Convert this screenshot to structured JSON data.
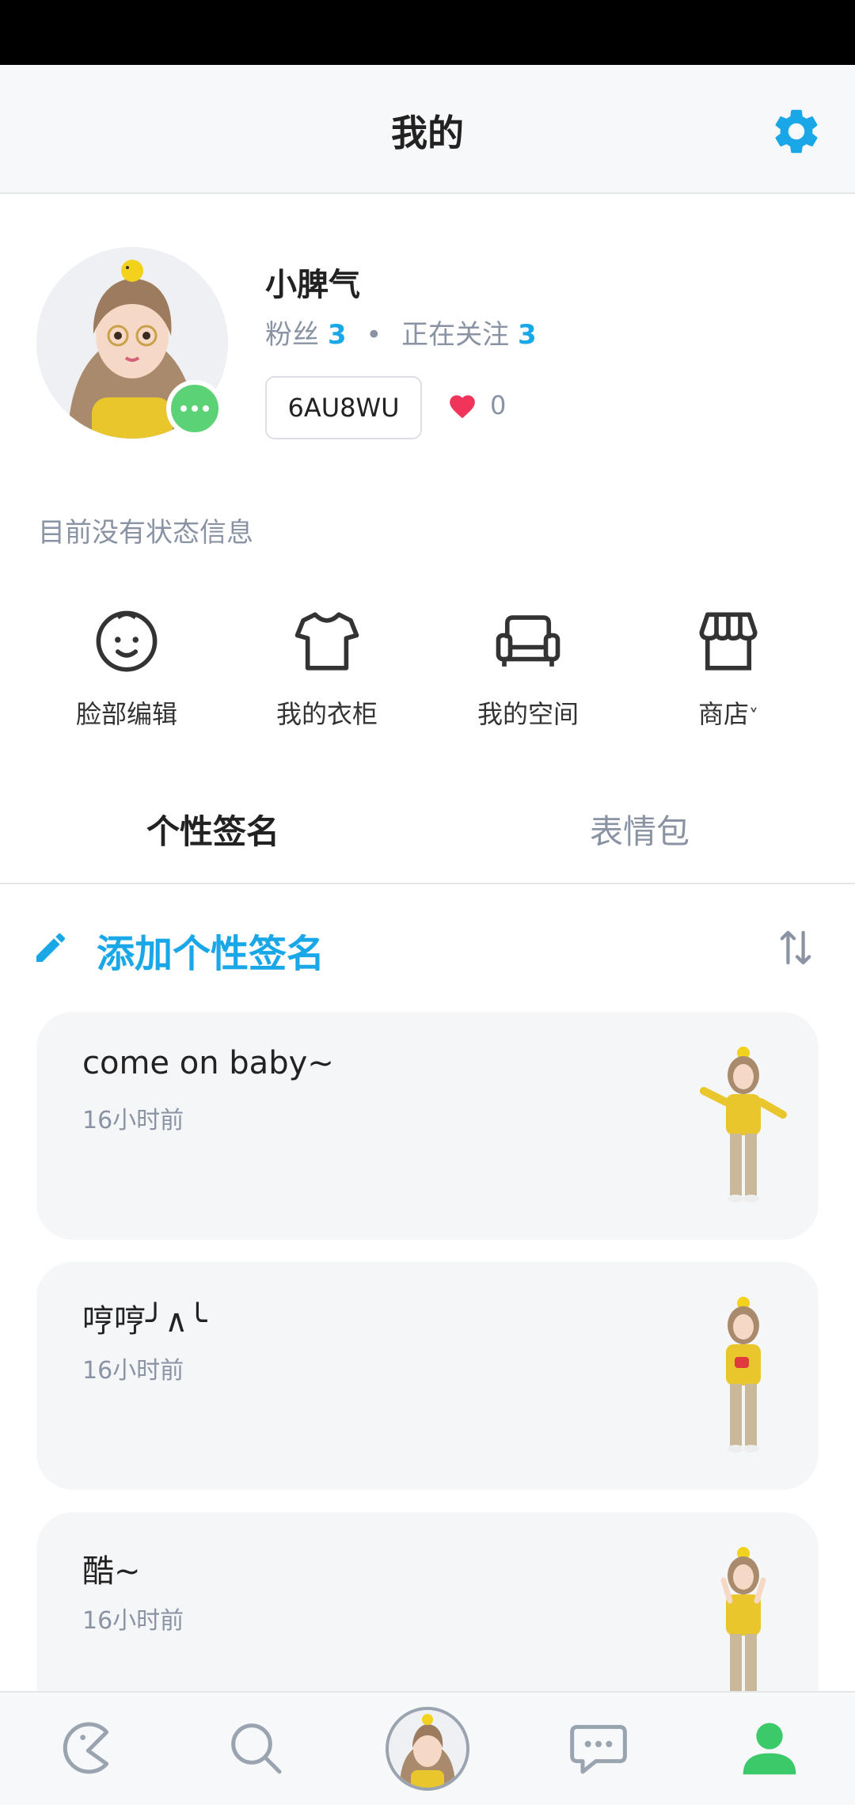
{
  "header": {
    "title": "我的",
    "settings_icon": "gear-icon"
  },
  "profile": {
    "name": "小脾气",
    "fans_label": "粉丝",
    "fans_count": "3",
    "following_label": "正在关注",
    "following_count": "3",
    "separator": "•",
    "user_id": "6AU8WU",
    "likes": "0",
    "status_message": "目前没有状态信息"
  },
  "tools": [
    {
      "label": "脸部编辑",
      "icon": "face-icon"
    },
    {
      "label": "我的衣柜",
      "icon": "shirt-icon"
    },
    {
      "label": "我的空间",
      "icon": "sofa-icon"
    },
    {
      "label": "商店",
      "icon": "store-icon",
      "suffix": "˅"
    }
  ],
  "tabs": [
    {
      "label": "个性签名",
      "active": true
    },
    {
      "label": "表情包",
      "active": false
    }
  ],
  "add_signature": {
    "label": "添加个性签名"
  },
  "signatures": [
    {
      "text": "come on baby~",
      "time": "16小时前"
    },
    {
      "text": "哼哼╯∧╰",
      "time": "16小时前"
    },
    {
      "text": "酷~",
      "time": "16小时前"
    }
  ],
  "bottom_nav": [
    {
      "name": "home",
      "icon": "pacman-icon"
    },
    {
      "name": "search",
      "icon": "search-icon"
    },
    {
      "name": "avatar",
      "icon": "avatar-icon"
    },
    {
      "name": "messages",
      "icon": "chat-icon"
    },
    {
      "name": "profile",
      "icon": "person-icon",
      "active": true
    }
  ],
  "colors": {
    "accent": "#1aa7e8",
    "green": "#5ad275",
    "heart": "#f0345a",
    "muted": "#8a93a3"
  }
}
